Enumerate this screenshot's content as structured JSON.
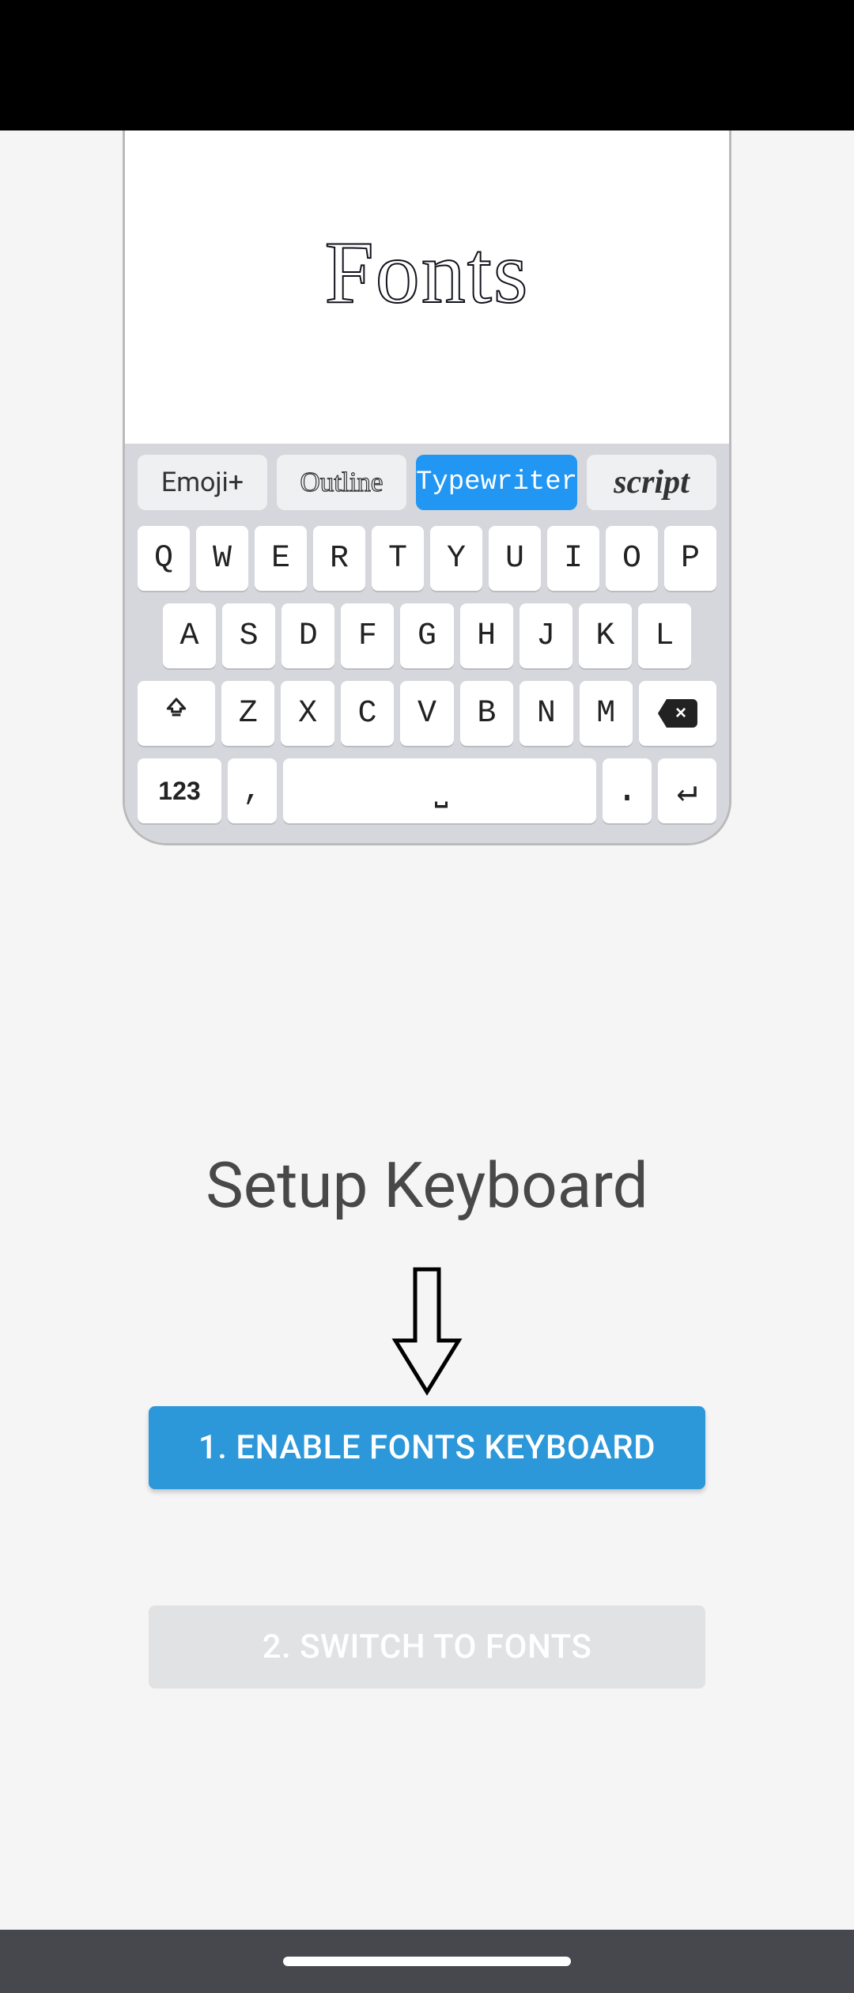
{
  "phone": {
    "title": "Fonts",
    "tabs": [
      "Emoji+",
      "Outline",
      "Typewriter",
      "script"
    ],
    "row1": [
      "Q",
      "W",
      "E",
      "R",
      "T",
      "Y",
      "U",
      "I",
      "O",
      "P"
    ],
    "row2": [
      "A",
      "S",
      "D",
      "F",
      "G",
      "H",
      "J",
      "K",
      "L"
    ],
    "row3": [
      "Z",
      "X",
      "C",
      "V",
      "B",
      "N",
      "M"
    ],
    "bksp_x": "×",
    "num_key": "123",
    "comma_key": ",",
    "space_glyph": "⎵",
    "period_key": ".",
    "enter_glyph": "↵"
  },
  "setup": {
    "title": "Setup Keyboard"
  },
  "buttons": {
    "enable": "1. ENABLE FONTS KEYBOARD",
    "switch": "2. SWITCH TO FONTS"
  }
}
